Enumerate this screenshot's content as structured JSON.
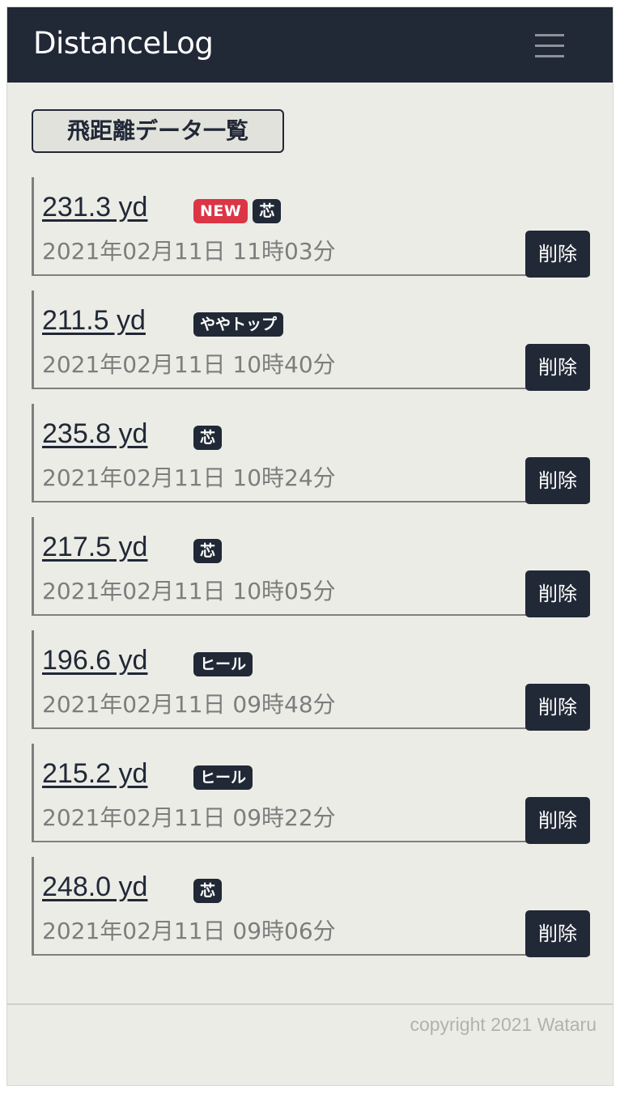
{
  "navbar": {
    "brand": "DistanceLog",
    "menu_icon": "hamburger-menu-icon"
  },
  "page": {
    "title": "飛距離データ一覧"
  },
  "entries": [
    {
      "distance": "231.3 yd",
      "badges": [
        "NEW",
        "芯"
      ],
      "timestamp": "2021年02月11日 11時03分",
      "delete_label": "削除"
    },
    {
      "distance": "211.5 yd",
      "badges": [
        "ややトップ"
      ],
      "timestamp": "2021年02月11日 10時40分",
      "delete_label": "削除"
    },
    {
      "distance": "235.8 yd",
      "badges": [
        "芯"
      ],
      "timestamp": "2021年02月11日 10時24分",
      "delete_label": "削除"
    },
    {
      "distance": "217.5 yd",
      "badges": [
        "芯"
      ],
      "timestamp": "2021年02月11日 10時05分",
      "delete_label": "削除"
    },
    {
      "distance": "196.6 yd",
      "badges": [
        "ヒール"
      ],
      "timestamp": "2021年02月11日 09時48分",
      "delete_label": "削除"
    },
    {
      "distance": "215.2 yd",
      "badges": [
        "ヒール"
      ],
      "timestamp": "2021年02月11日 09時22分",
      "delete_label": "削除"
    },
    {
      "distance": "248.0 yd",
      "badges": [
        "芯"
      ],
      "timestamp": "2021年02月11日 09時06分",
      "delete_label": "削除"
    }
  ],
  "footer": {
    "copyright": "copyright 2021 Wataru"
  },
  "colors": {
    "navbar": "#212836",
    "background": "#ecece7",
    "new_badge": "#dc3545",
    "badge": "#212836"
  }
}
